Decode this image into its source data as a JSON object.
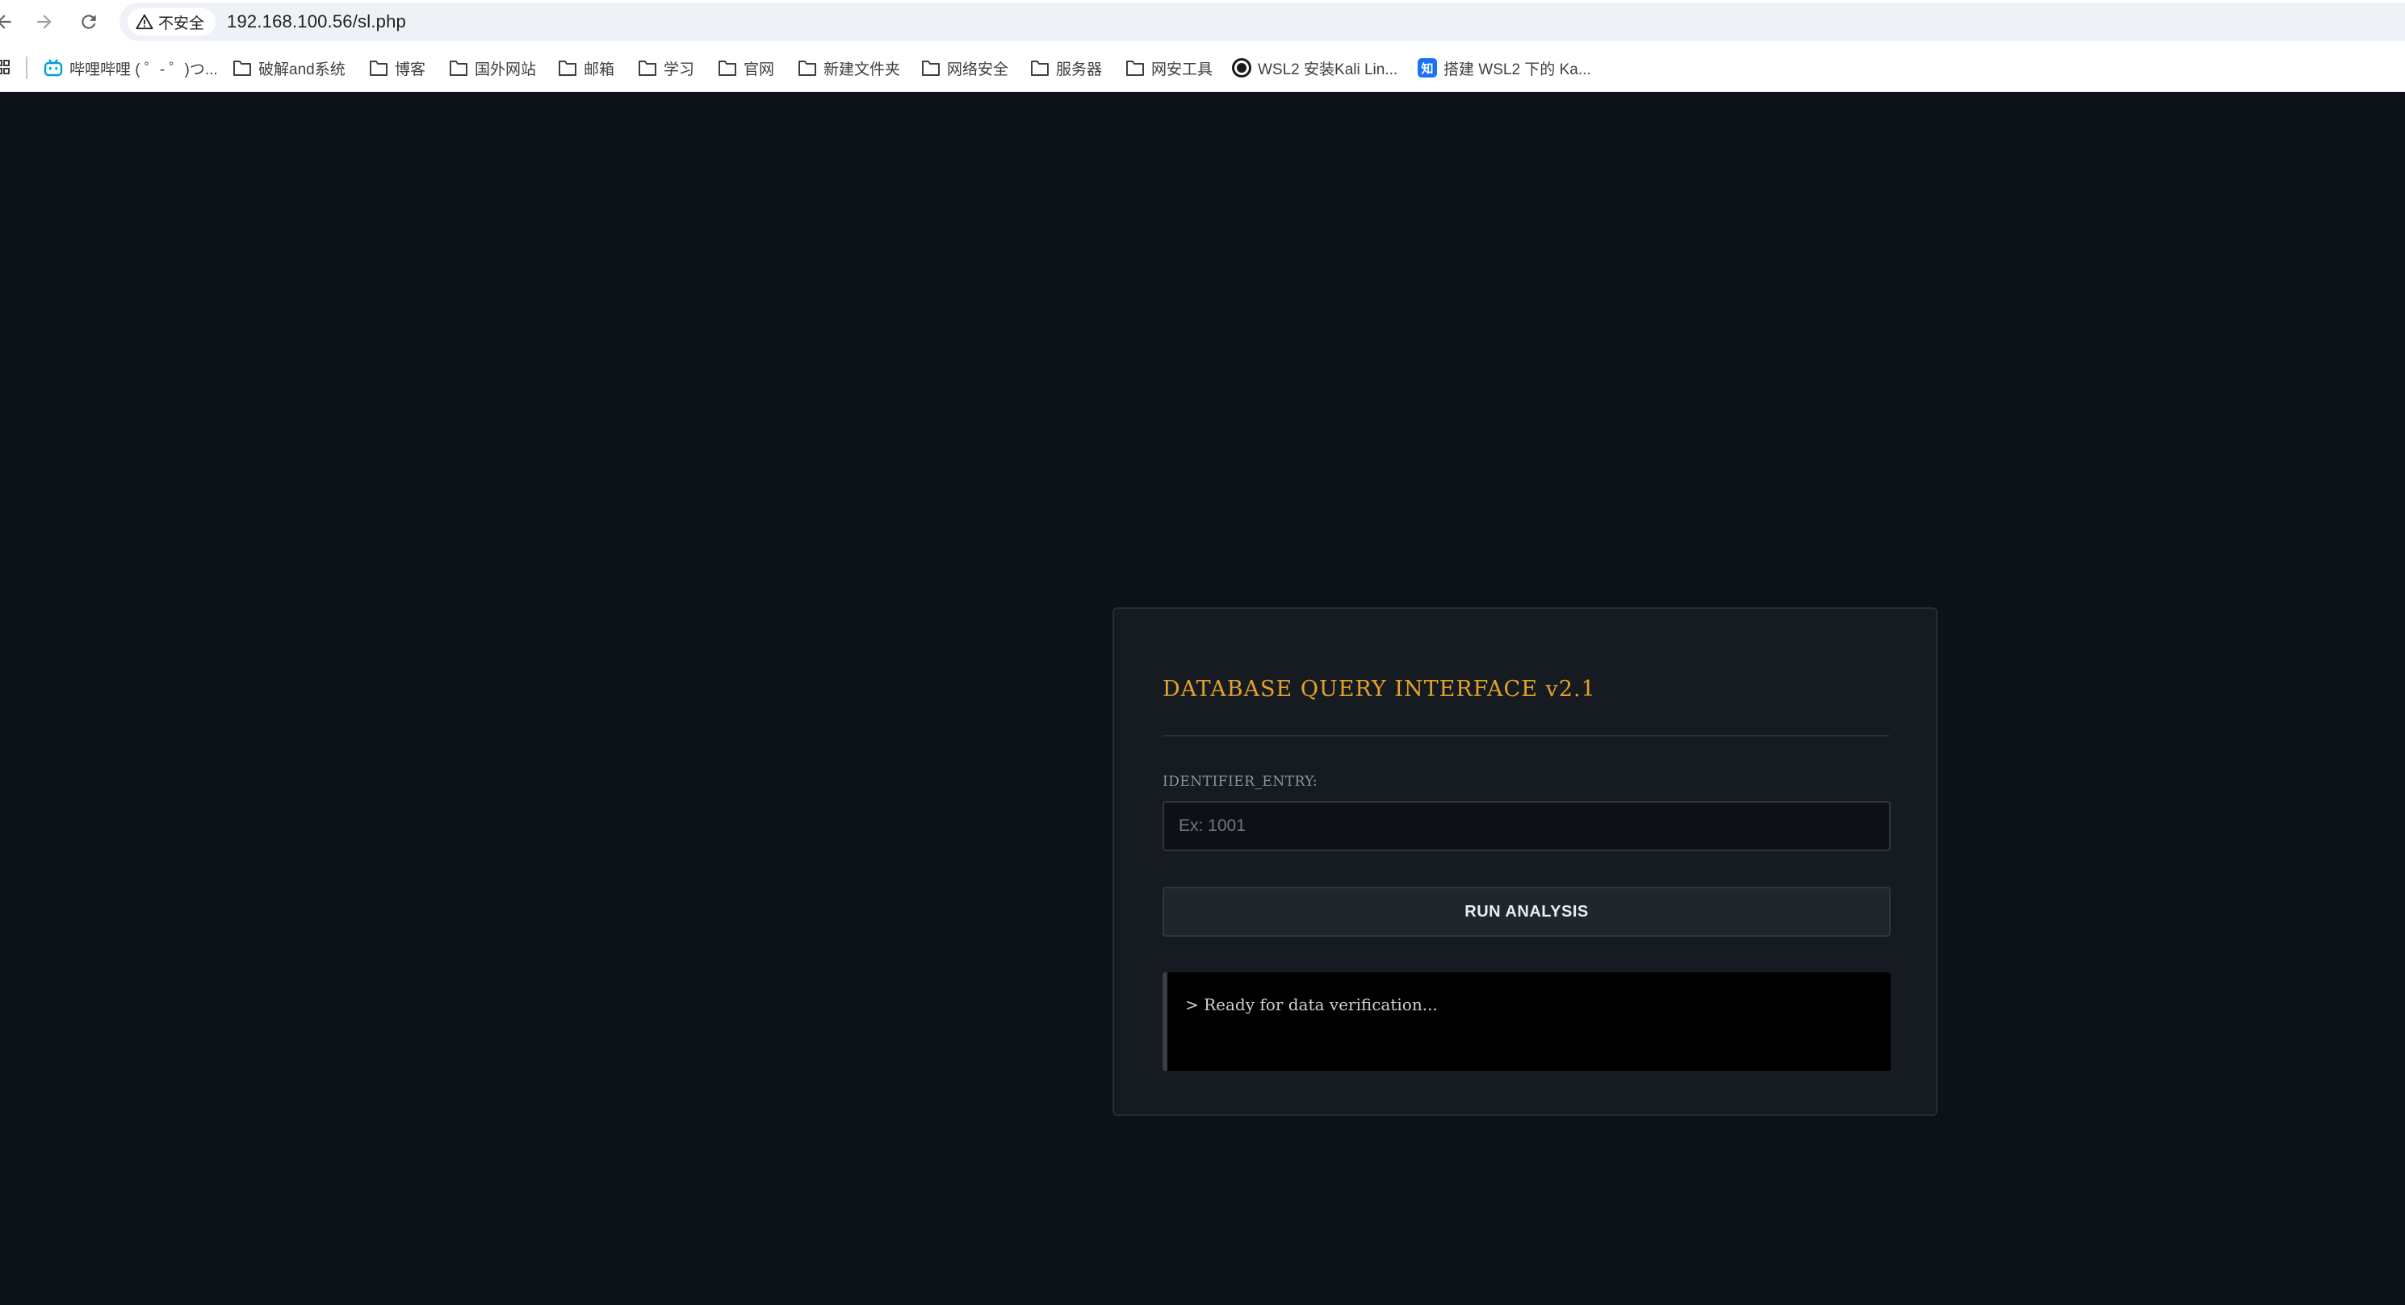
{
  "browser": {
    "security_label": "不安全",
    "url": "192.168.100.56/sl.php"
  },
  "bookmarks": [
    {
      "label": "哔哩哔哩 ( ゜- ゜)つ...",
      "icon": "bilibili-icon"
    },
    {
      "label": "破解and系统",
      "icon": "folder-icon"
    },
    {
      "label": "博客",
      "icon": "folder-icon"
    },
    {
      "label": "国外网站",
      "icon": "folder-icon"
    },
    {
      "label": "邮箱",
      "icon": "folder-icon"
    },
    {
      "label": "学习",
      "icon": "folder-icon"
    },
    {
      "label": "官网",
      "icon": "folder-icon"
    },
    {
      "label": "新建文件夹",
      "icon": "folder-icon"
    },
    {
      "label": "网络安全",
      "icon": "folder-icon"
    },
    {
      "label": "服务器",
      "icon": "folder-icon"
    },
    {
      "label": "网安工具",
      "icon": "folder-icon"
    },
    {
      "label": "WSL2 安装Kali Lin...",
      "icon": "circle-site-icon"
    },
    {
      "label": "搭建 WSL2 下的 Ka...",
      "icon": "zhihu-icon"
    }
  ],
  "panel": {
    "title": "DATABASE QUERY INTERFACE v2.1",
    "field_label": "IDENTIFIER_ENTRY:",
    "input_value": "",
    "input_placeholder": "Ex: 1001",
    "button_label": "RUN ANALYSIS",
    "console_text": "> Ready for data verification..."
  },
  "colors": {
    "page_background": "#0d1118",
    "panel_background": "#161b22",
    "title_accent": "#e3a326"
  }
}
